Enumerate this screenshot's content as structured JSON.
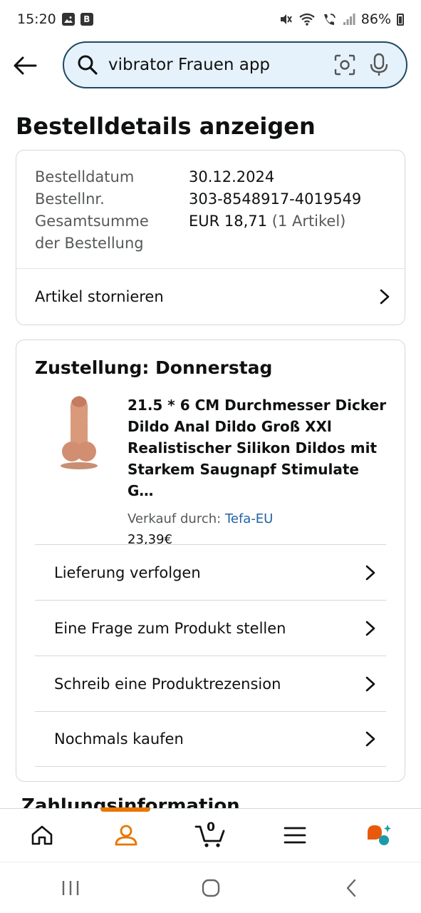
{
  "status_bar": {
    "time": "15:20",
    "battery": "86%",
    "left_icons": [
      "image-icon",
      "b-app-icon"
    ],
    "right_icons": [
      "mute-icon",
      "wifi-icon",
      "wifi-call-icon",
      "signal-icon"
    ]
  },
  "search": {
    "query": "vibrator Frauen app"
  },
  "page": {
    "title": "Bestelldetails anzeigen"
  },
  "order": {
    "date_label": "Bestelldatum",
    "date_value": "30.12.2024",
    "number_label": "Bestellnr.",
    "number_value": "303-8548917-4019549",
    "total_label_line1": "Gesamtsumme",
    "total_label_line2": "der Bestellung",
    "total_value": "EUR 18,71",
    "total_items": "(1 Artikel)",
    "cancel_label": "Artikel stornieren"
  },
  "delivery": {
    "title": "Zustellung: Donnerstag",
    "product_name": "21.5 * 6 CM Durchmesser Dicker Dildo Anal Dildo Groß XXl Realistischer Silikon Dildos mit Starkem Saugnapf Stimulate G…",
    "seller_prefix": "Verkauf durch:",
    "seller_name": "Tefa-EU",
    "price": "23,39€",
    "actions": [
      "Lieferung verfolgen",
      "Eine Frage zum Produkt stellen",
      "Schreib eine Produktrezension",
      "Nochmals kaufen"
    ]
  },
  "next_section_heading": "Zahlungsinformation",
  "bottom_nav": {
    "items": [
      "home-icon",
      "account-icon",
      "cart-icon",
      "menu-icon",
      "rufus-icon"
    ],
    "cart_count": "0",
    "active_index": 1,
    "accent_color": "#e77600"
  },
  "colors": {
    "search_border": "#1e4a63",
    "search_bg": "#e6f2fb",
    "link": "#2162a1"
  }
}
